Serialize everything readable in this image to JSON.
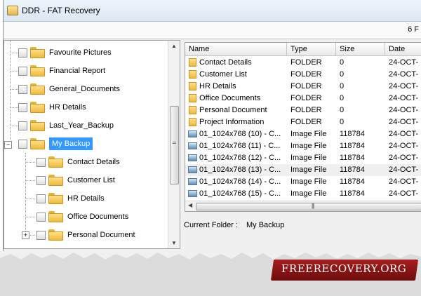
{
  "window": {
    "title": "DDR - FAT Recovery",
    "item_count": "6 F"
  },
  "tree": {
    "items": [
      {
        "label": "Favourite Pictures"
      },
      {
        "label": "Financial Report"
      },
      {
        "label": "General_Documents"
      },
      {
        "label": "HR Details"
      },
      {
        "label": "Last_Year_Backup"
      },
      {
        "label": "My Backup",
        "selected": true,
        "expanded": true
      },
      {
        "label": "Contact Details"
      },
      {
        "label": "Customer List"
      },
      {
        "label": "HR Details"
      },
      {
        "label": "Office Documents"
      },
      {
        "label": "Personal Document"
      }
    ],
    "expander_minus": "−",
    "expander_plus": "+"
  },
  "file_list": {
    "columns": [
      "Name",
      "Type",
      "Size",
      "Date"
    ],
    "rows": [
      {
        "icon": "folder-icon",
        "name": "Contact Details",
        "type": "FOLDER",
        "size": "0",
        "date": "24-OCT-"
      },
      {
        "icon": "folder-icon",
        "name": "Customer List",
        "type": "FOLDER",
        "size": "0",
        "date": "24-OCT-"
      },
      {
        "icon": "folder-icon",
        "name": "HR Details",
        "type": "FOLDER",
        "size": "0",
        "date": "24-OCT-"
      },
      {
        "icon": "folder-icon",
        "name": "Office Documents",
        "type": "FOLDER",
        "size": "0",
        "date": "24-OCT-"
      },
      {
        "icon": "folder-icon",
        "name": "Personal Document",
        "type": "FOLDER",
        "size": "0",
        "date": "24-OCT-"
      },
      {
        "icon": "folder-icon",
        "name": "Project Information",
        "type": "FOLDER",
        "size": "0",
        "date": "24-OCT-"
      },
      {
        "icon": "image-file-icon",
        "name": "01_1024x768 (10) - C...",
        "type": "Image File",
        "size": "118784",
        "date": "24-OCT-"
      },
      {
        "icon": "image-file-icon",
        "name": "01_1024x768 (11) - C...",
        "type": "Image File",
        "size": "118784",
        "date": "24-OCT-"
      },
      {
        "icon": "image-file-icon",
        "name": "01_1024x768 (12) - C...",
        "type": "Image File",
        "size": "118784",
        "date": "24-OCT-"
      },
      {
        "icon": "image-file-icon",
        "name": "01_1024x768 (13) - C...",
        "type": "Image File",
        "size": "118784",
        "date": "24-OCT-"
      },
      {
        "icon": "image-file-icon",
        "name": "01_1024x768 (14) - C...",
        "type": "Image File",
        "size": "118784",
        "date": "24-OCT-"
      },
      {
        "icon": "image-file-icon",
        "name": "01_1024x768 (15) - C...",
        "type": "Image File",
        "size": "118784",
        "date": "24-OCT-"
      }
    ]
  },
  "current_folder": {
    "label": "Current Folder :",
    "value": "My Backup"
  },
  "watermark": "FREERECOVERY.ORG",
  "colors": {
    "selection": "#3399ff",
    "banner": "#8b1414"
  }
}
